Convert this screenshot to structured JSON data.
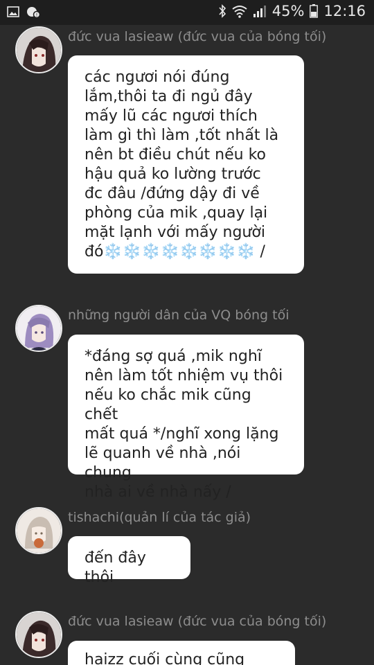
{
  "status_bar": {
    "battery": "45%",
    "time": "12:16",
    "icons": [
      "image-icon",
      "notification-badge-icon",
      "bluetooth-icon",
      "wifi-icon",
      "signal-icon",
      "battery-icon"
    ]
  },
  "messages": [
    {
      "user": "đức vua lasieaw (đức vua của bóng tối)",
      "avatar": "dark-haired-character-avatar",
      "text": "các ngươi nói đúng\nlắm,thôi ta đi ngủ đây\nmấy lũ các ngươi thích\nlàm gì thì làm ,tốt nhất là\nnên bt điều chút nếu ko\nhậu quả ko lường trước\nđc đâu /đứng dậy đi về\nphòng của mik ,quay lại\nmặt lạnh với mấy người\nđó❄️❄️❄️❄️❄️❄️❄️❄️ /"
    },
    {
      "user": "những người dân của VQ bóng tối",
      "avatar": "purple-haired-character-avatar",
      "text": "*đáng sợ quá ,mik nghĩ\nnên làm tốt nhiệm vụ thôi\nnếu ko chắc mik cũng chết\nmất quá */nghĩ xong lặng\nlẽ quanh về nhà ,nói chung\nnhà ai về nhà nấy /"
    },
    {
      "user": "tishachi(quản lí của tác giả)",
      "avatar": "light-haired-character-avatar",
      "text": "đến đây thôi"
    },
    {
      "user": "đức vua lasieaw (đức vua của bóng tối)",
      "avatar": "dark-haired-character-avatar",
      "text": "haizz cuối cùng cũng xong"
    }
  ]
}
